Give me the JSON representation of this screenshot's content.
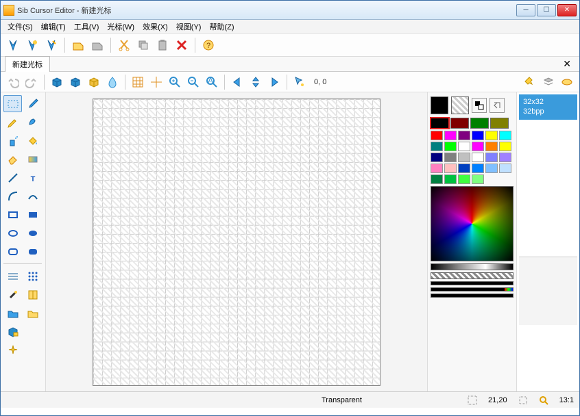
{
  "window": {
    "title": "Sib Cursor Editor - 新建光标"
  },
  "menu": {
    "items": [
      "文件(S)",
      "编辑(T)",
      "工具(V)",
      "光标(W)",
      "效果(X)",
      "视图(Y)",
      "帮助(Z)"
    ]
  },
  "tab": {
    "label": "新建光标"
  },
  "toolbar2": {
    "coord": "0, 0"
  },
  "status": {
    "transparent": "Transparent",
    "pos": "21,20",
    "zoom": "13:1"
  },
  "size_panel": {
    "dim": "32x32",
    "depth": "32bpp"
  },
  "palette_main": [
    "#000000",
    "#800000",
    "#008000",
    "#808000"
  ],
  "palette": [
    "#ff0000",
    "#ff00ff",
    "#800080",
    "#0000ff",
    "#ffff00",
    "#00ffff",
    "#008080",
    "#00ff00",
    "#ffffff",
    "#ff00ff",
    "#ff8000",
    "#ffff00",
    "#000080",
    "#808080",
    "#c0c0c0",
    "#ffffff",
    "#8080ff",
    "#a080ff",
    "#ff80c0",
    "#ffc0c0",
    "#0040c0",
    "#0080ff",
    "#80c0ff",
    "#c0e0ff",
    "#008040",
    "#00c040",
    "#40ff40",
    "#80ff80"
  ]
}
